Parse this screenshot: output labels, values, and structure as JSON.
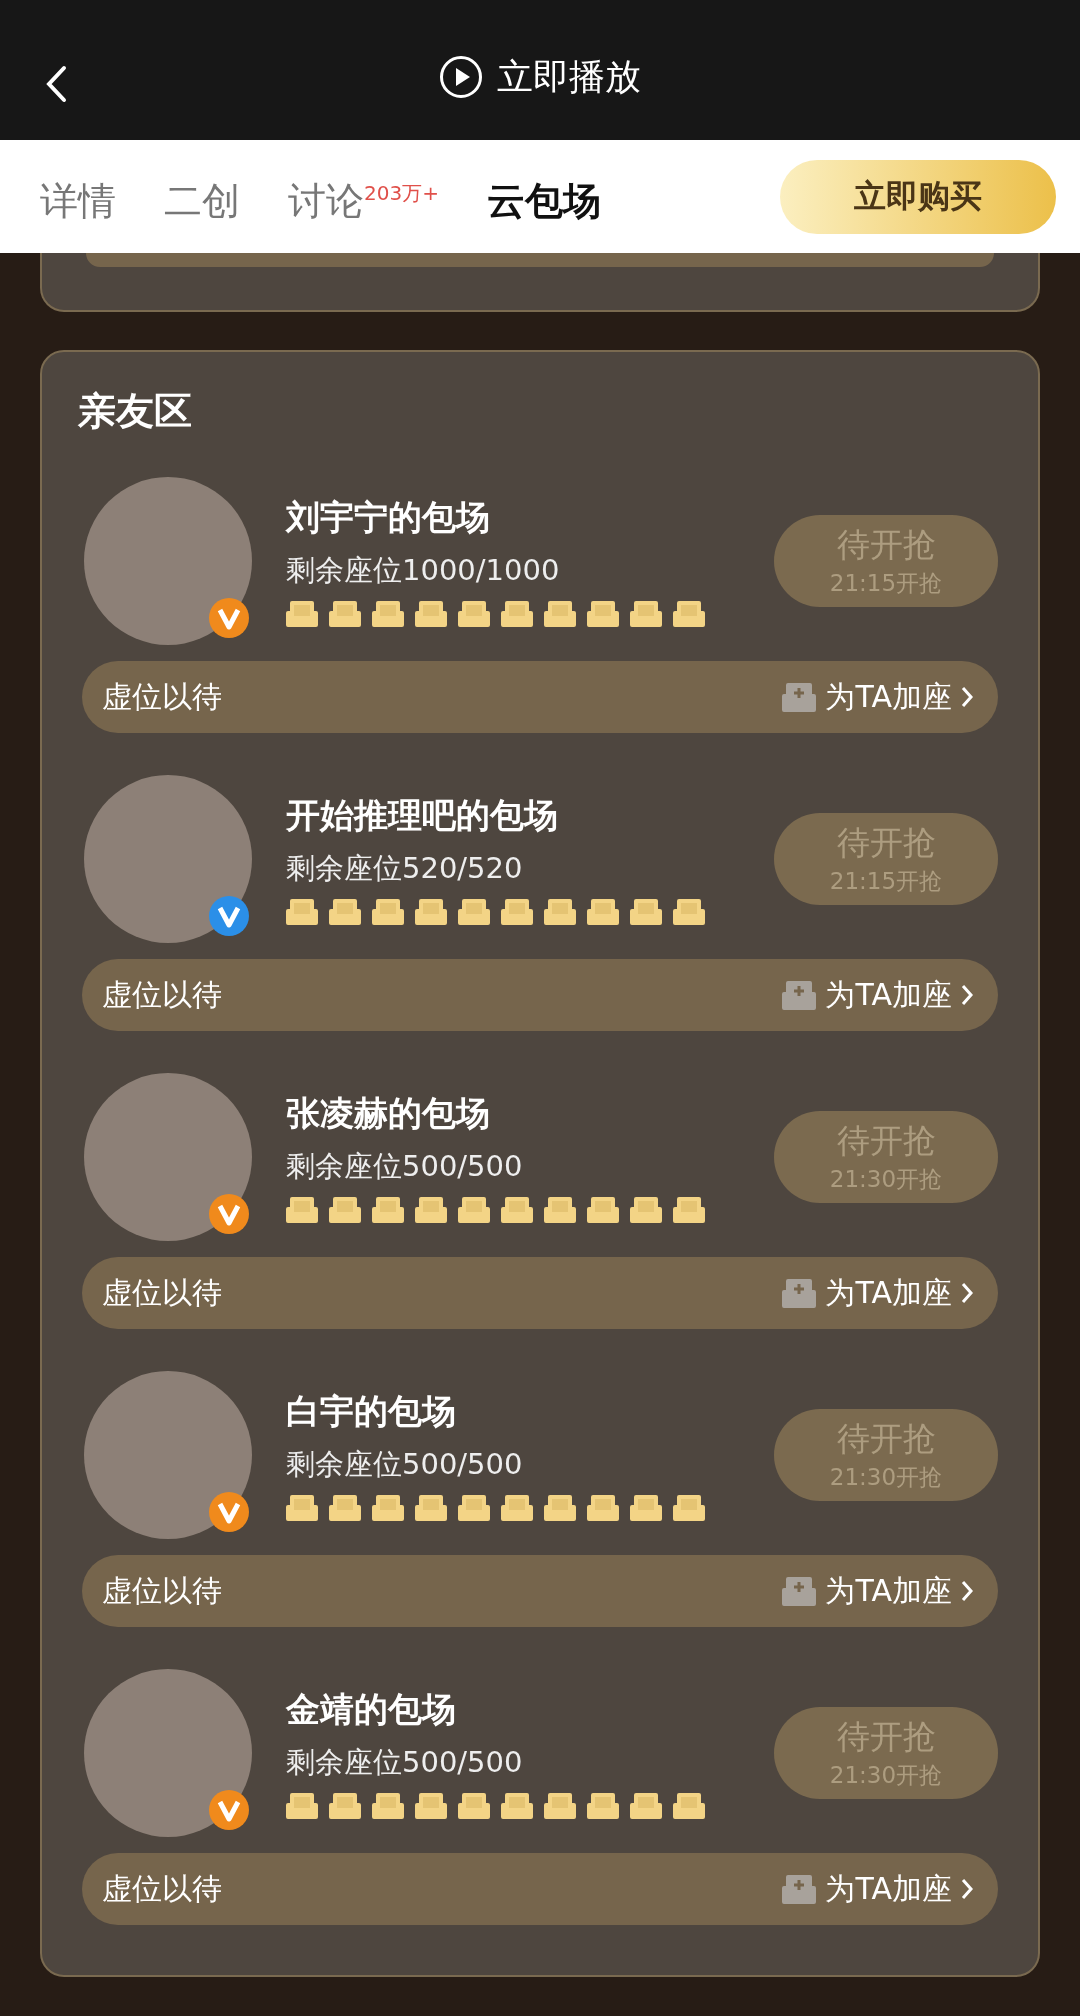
{
  "header": {
    "play_label": "立即播放"
  },
  "tabs": [
    {
      "label": "详情",
      "selected": false
    },
    {
      "label": "二创",
      "selected": false
    },
    {
      "label": "讨论",
      "selected": false,
      "badge": "203万+"
    },
    {
      "label": "云包场",
      "selected": true
    }
  ],
  "buy_button": "立即购买",
  "section": {
    "title": "亲友区",
    "sessions": [
      {
        "name": "刘宇宁的包场",
        "seats": "剩余座位1000/1000",
        "button": "待开抢",
        "time": "21:15开抢",
        "color": "#f08a1c",
        "footer": "虚位以待",
        "action": "为TA加座"
      },
      {
        "name": "开始推理吧的包场",
        "seats": "剩余座位520/520",
        "button": "待开抢",
        "time": "21:15开抢",
        "color": "#2b8fe8",
        "footer": "虚位以待",
        "action": "为TA加座"
      },
      {
        "name": "张凌赫的包场",
        "seats": "剩余座位500/500",
        "button": "待开抢",
        "time": "21:30开抢",
        "color": "#f08a1c",
        "footer": "虚位以待",
        "action": "为TA加座"
      },
      {
        "name": "白宇的包场",
        "seats": "剩余座位500/500",
        "button": "待开抢",
        "time": "21:30开抢",
        "color": "#f08a1c",
        "footer": "虚位以待",
        "action": "为TA加座"
      },
      {
        "name": "金靖的包场",
        "seats": "剩余座位500/500",
        "button": "待开抢",
        "time": "21:30开抢",
        "color": "#f08a1c",
        "footer": "虚位以待",
        "action": "为TA加座"
      }
    ]
  }
}
